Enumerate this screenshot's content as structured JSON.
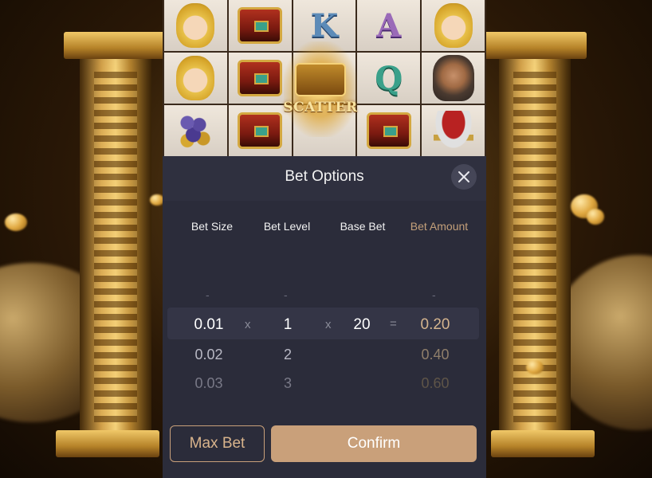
{
  "bet_options": {
    "title": "Bet Options",
    "columns": {
      "bet_size": "Bet Size",
      "bet_level": "Bet Level",
      "base_bet": "Base Bet",
      "bet_amount": "Bet Amount"
    },
    "dash": "-",
    "operators": {
      "times": "x",
      "equals": "="
    },
    "selected": {
      "bet_size": "0.01",
      "bet_level": "1",
      "base_bet": "20",
      "bet_amount": "0.20"
    },
    "rows": [
      {
        "bet_size": "0.02",
        "bet_level": "2",
        "bet_amount": "0.40"
      },
      {
        "bet_size": "0.03",
        "bet_level": "3",
        "bet_amount": "0.60"
      }
    ],
    "max_bet_label": "Max Bet",
    "confirm_label": "Confirm"
  },
  "reels": {
    "scatter_label": "SCATTER",
    "letters": [
      "K",
      "A",
      "Q"
    ]
  },
  "colors": {
    "panel_bg": "#2b2c3a",
    "accent": "#c9a07a",
    "text_light": "#f2f2f2"
  },
  "icons": [
    "close-icon"
  ]
}
